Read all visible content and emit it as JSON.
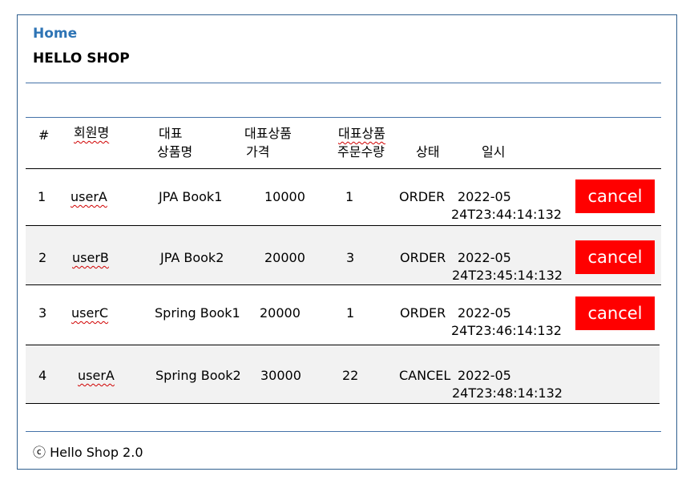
{
  "header": {
    "home_link": "Home",
    "brand": "HELLO SHOP"
  },
  "table": {
    "columns": {
      "num": "#",
      "member": "회원명",
      "item_line1": "대표",
      "item_line2": "상품명",
      "price_line1": "대표상품",
      "price_line2": "가격",
      "qty_line1": "대표상품",
      "qty_line2": "주문수량",
      "status": "상태",
      "date": "일시"
    },
    "rows": [
      {
        "num": "1",
        "member": "userA",
        "item": "JPA Book1",
        "price": "10000",
        "qty": "1",
        "status": "ORDER",
        "date_line1": "2022-05",
        "date_line2": "24T23:44:14:132",
        "action": "cancel"
      },
      {
        "num": "2",
        "member": "userB",
        "item": "JPA Book2",
        "price": "20000",
        "qty": "3",
        "status": "ORDER",
        "date_line1": "2022-05",
        "date_line2": "24T23:45:14:132",
        "action": "cancel"
      },
      {
        "num": "3",
        "member": "userC",
        "item": "Spring Book1",
        "price": "20000",
        "qty": "1",
        "status": "ORDER",
        "date_line1": "2022-05",
        "date_line2": "24T23:46:14:132",
        "action": "cancel"
      },
      {
        "num": "4",
        "member": "userA",
        "item": "Spring Book2",
        "price": "30000",
        "qty": "22",
        "status": "CANCEL",
        "date_line1": "2022-05",
        "date_line2": "24T23:48:14:132",
        "action": ""
      }
    ]
  },
  "footer": {
    "text": "ⓒ Hello Shop 2.0"
  },
  "colors": {
    "cancel_button": "#ff0000",
    "home_link": "#2e74b5",
    "striped_row": "#f2f2f2"
  }
}
